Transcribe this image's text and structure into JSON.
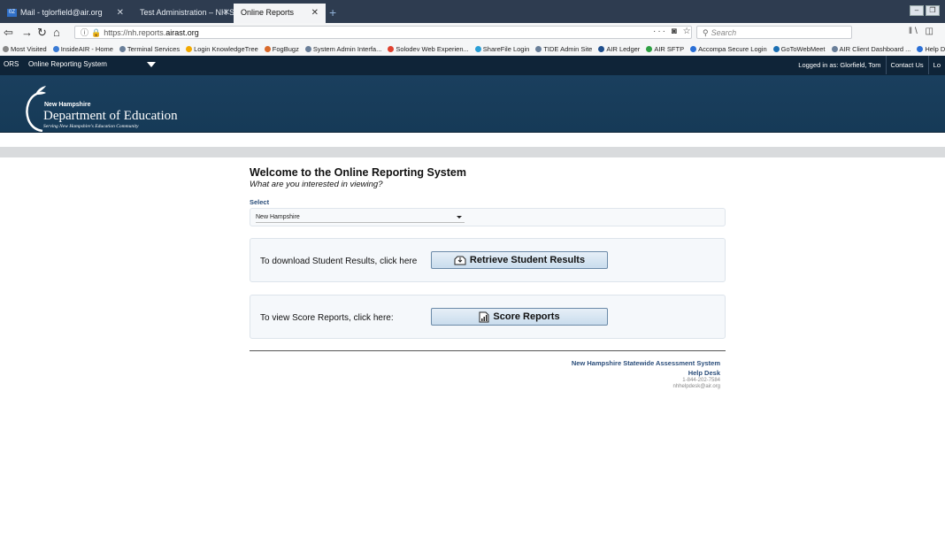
{
  "browser": {
    "tabs": [
      {
        "label": "Mail - tglorfield@air.org",
        "active": false
      },
      {
        "label": "Test Administration – NH State",
        "active": false
      },
      {
        "label": "Online Reports",
        "active": true
      }
    ],
    "new_tab": "+",
    "url_prefix": "https://nh.reports.",
    "url_host": "airast.org",
    "search_placeholder": "Search",
    "bookmarks": [
      "Most Visited",
      "InsideAIR - Home",
      "Terminal Services",
      "Login KnowledgeTree",
      "FogBugz",
      "System Admin Interfa...",
      "Solodev Web Experien...",
      "ShareFile Login",
      "TIDE Admin Site",
      "AIR Ledger",
      "AIR SFTP",
      "Accompa Secure Login",
      "GoToWebMeet",
      "AIR Client Dashboard ...",
      "Help Desk Reports"
    ]
  },
  "ors": {
    "label": "ORS",
    "system_select": "Online Reporting System",
    "logged_in": "Logged in as: Glorfield, Tom",
    "contact": "Contact Us",
    "logout": "Lo"
  },
  "logo": {
    "state": "New Hampshire",
    "dept": "Department of Education",
    "tagline": "Serving New Hampshire's Education Community"
  },
  "main": {
    "welcome": "Welcome to the Online Reporting System",
    "question": "What are you interested in viewing?",
    "select_label": "Select",
    "selected_value": "New Hampshire",
    "download_text": "To download Student Results, click here",
    "download_button": "Retrieve Student Results",
    "reports_text": "To view Score Reports, click here:",
    "reports_button": "Score Reports"
  },
  "footer": {
    "system": "New Hampshire Statewide Assessment System",
    "helpdesk": "Help Desk",
    "phone": "1-844-202-7584",
    "email": "nhhelpdesk@air.org"
  }
}
